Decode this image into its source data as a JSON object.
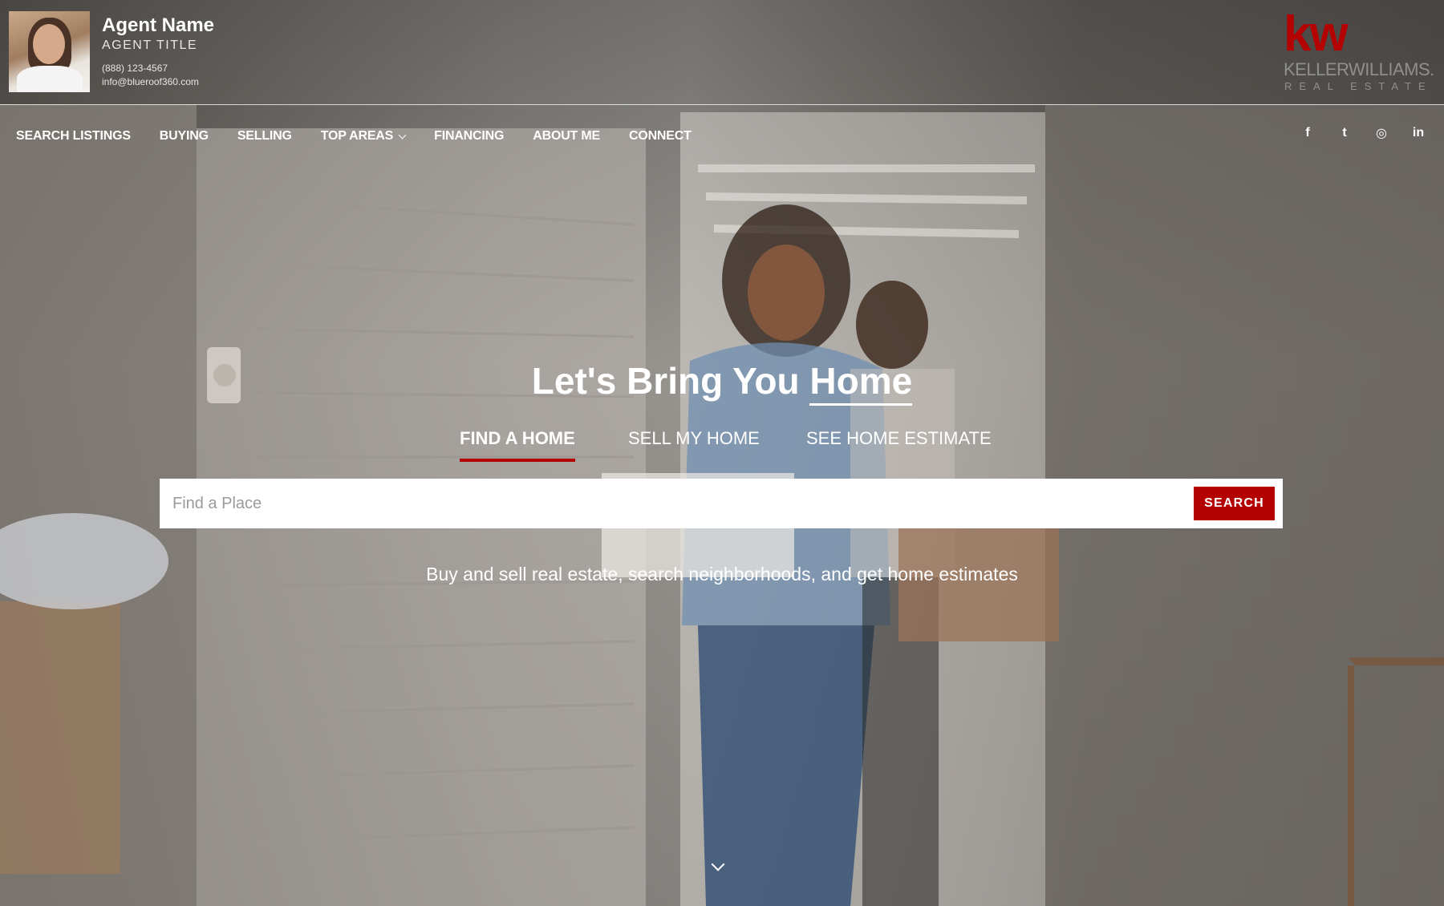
{
  "agent": {
    "name": "Agent Name",
    "title": "AGENT TITLE",
    "phone": "(888) 123-4567",
    "email": "info@blueroof360.com"
  },
  "brand": {
    "logo": "kw",
    "name": "KELLERWILLIAMS.",
    "sub": "REAL ESTATE",
    "color": "#b40101"
  },
  "nav": {
    "items": [
      {
        "label": "SEARCH LISTINGS"
      },
      {
        "label": "BUYING"
      },
      {
        "label": "SELLING"
      },
      {
        "label": "TOP AREAS",
        "dropdown": true
      },
      {
        "label": "FINANCING"
      },
      {
        "label": "ABOUT ME"
      },
      {
        "label": "CONNECT"
      }
    ]
  },
  "social": {
    "icons": [
      "facebook-icon",
      "twitter-icon",
      "instagram-icon",
      "linkedin-icon"
    ],
    "glyphs": [
      "f",
      "t",
      "◎",
      "in"
    ]
  },
  "hero": {
    "title_prefix": "Let's Bring You ",
    "title_highlight": "Home",
    "tabs": [
      {
        "label": "FIND A HOME",
        "active": true
      },
      {
        "label": "SELL MY HOME",
        "active": false
      },
      {
        "label": "SEE HOME ESTIMATE",
        "active": false
      }
    ],
    "search": {
      "placeholder": "Find a Place",
      "button_label": "SEARCH"
    },
    "subtitle": "Buy and sell real estate, search neighborhoods, and get home estimates"
  },
  "colors": {
    "accent": "#b40101"
  }
}
